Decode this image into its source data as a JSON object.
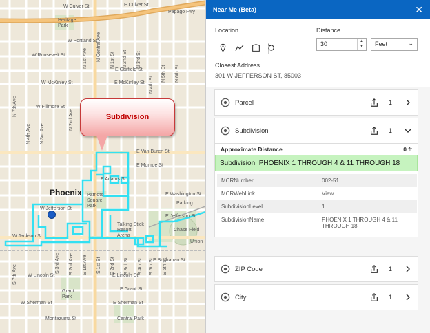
{
  "map": {
    "callout_label": "Subdivision",
    "city_label": "Phoenix",
    "streets_h": [
      {
        "text": "W Culver St"
      },
      {
        "text": "E Culver St"
      },
      {
        "text": "Papago Fwy"
      },
      {
        "text": "W Portland St"
      },
      {
        "text": "W Roosevelt St"
      },
      {
        "text": "E Garfield St"
      },
      {
        "text": "W McKinley St"
      },
      {
        "text": "E McKinley St"
      },
      {
        "text": "W Fillmore St"
      },
      {
        "text": "E Van Buren St"
      },
      {
        "text": "E Monroe St"
      },
      {
        "text": "E Adams St"
      },
      {
        "text": "E Washington St"
      },
      {
        "text": "W Jefferson St"
      },
      {
        "text": "E Jefferson St"
      },
      {
        "text": "W Jackson St"
      },
      {
        "text": "E Buchanan St"
      },
      {
        "text": "W Lincoln St"
      },
      {
        "text": "E Lincoln St"
      },
      {
        "text": "E Grant St"
      },
      {
        "text": "W Sherman St"
      },
      {
        "text": "E Sherman St"
      },
      {
        "text": "Montezuma St"
      },
      {
        "text": "Talking Stick Resort Arena"
      },
      {
        "text": "Chase Field"
      },
      {
        "text": "Patriots Square Park"
      },
      {
        "text": "Heritage Park"
      },
      {
        "text": "Grant Park"
      },
      {
        "text": "Central Park"
      },
      {
        "text": "Parking"
      },
      {
        "text": "Union"
      }
    ],
    "streets_v": [
      {
        "text": "N 4th Ave"
      },
      {
        "text": "N 3rd Ave"
      },
      {
        "text": "N 2nd Ave"
      },
      {
        "text": "N 1st Ave"
      },
      {
        "text": "N Central Ave"
      },
      {
        "text": "N 1st St"
      },
      {
        "text": "N 2nd St"
      },
      {
        "text": "N 3rd St"
      },
      {
        "text": "N 4th St"
      },
      {
        "text": "N 5th St"
      },
      {
        "text": "N 6th St"
      },
      {
        "text": "S 2nd Ave"
      },
      {
        "text": "S 1st Ave"
      },
      {
        "text": "S 2nd St"
      },
      {
        "text": "S 3rd St"
      },
      {
        "text": "S 4th St"
      },
      {
        "text": "S 5th St"
      },
      {
        "text": "S 6th St"
      },
      {
        "text": "S 7th Ave"
      },
      {
        "text": "S 3rd Ave"
      },
      {
        "text": "S 1st St"
      },
      {
        "text": "N 7th Ave"
      }
    ],
    "colors": {
      "boundary": "#33e0f2",
      "dot": "#1a5cc5",
      "callout_text": "#c00000"
    }
  },
  "panel": {
    "title": "Near Me (Beta)",
    "location_label": "Location",
    "distance_label": "Distance",
    "distance_value": "30",
    "unit_value": "Feet",
    "closest_label": "Closest Address",
    "closest_value": "301 W JEFFERSON ST, 85003",
    "header_color": "#0a66c2",
    "layers": [
      {
        "name": "Parcel",
        "count": "1"
      },
      {
        "name": "Subdivision",
        "count": "1"
      },
      {
        "name": "ZIP Code",
        "count": "1"
      },
      {
        "name": "City",
        "count": "1"
      }
    ],
    "approx_label": "Approximate Distance",
    "approx_value": "0 ft",
    "feature_title": "Subdivision: PHOENIX 1 THROUGH 4 & 11 THROUGH 18",
    "attributes": [
      {
        "key": "MCRNumber",
        "value": "002-51"
      },
      {
        "key": "MCRWebLink",
        "value": "View"
      },
      {
        "key": "SubdivisionLevel",
        "value": "1"
      },
      {
        "key": "SubdivisionName",
        "value": "PHOENIX 1 THROUGH 4 & 11 THROUGH 18"
      }
    ]
  }
}
